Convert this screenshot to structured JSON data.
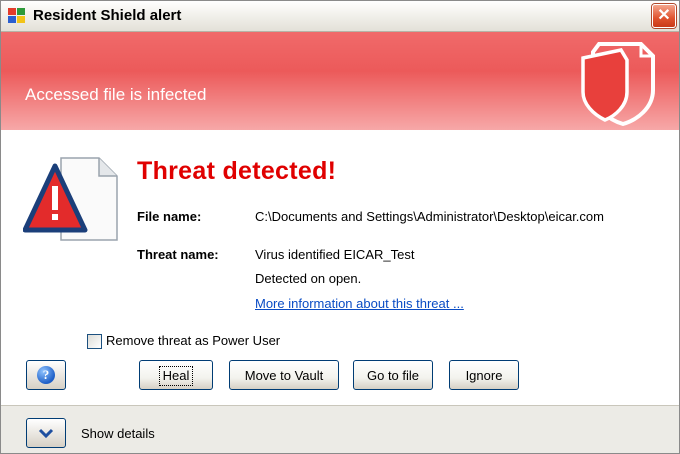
{
  "window": {
    "title": "Resident Shield alert",
    "close_glyph": "✕"
  },
  "banner": {
    "text": "Accessed file is infected",
    "icon": "shield-icon"
  },
  "alert": {
    "heading": "Threat detected!",
    "file_label": "File name:",
    "file_value": "C:\\Documents and Settings\\Administrator\\Desktop\\eicar.com",
    "threat_label": "Threat name:",
    "threat_value": "Virus identified EICAR_Test",
    "detected_note": "Detected on open.",
    "more_info_link": "More information about this threat ..."
  },
  "options": {
    "remove_power_user_label": "Remove threat as Power User",
    "remove_power_user_checked": false
  },
  "buttons": {
    "help_glyph": "?",
    "heal_label": "Heal",
    "vault_label": "Move to Vault",
    "goto_label": "Go to file",
    "ignore_label": "Ignore"
  },
  "footer": {
    "show_details_label": "Show details"
  },
  "colors": {
    "banner": "#ec5a5a",
    "heading": "#e00000",
    "link": "#0a4cc4"
  }
}
